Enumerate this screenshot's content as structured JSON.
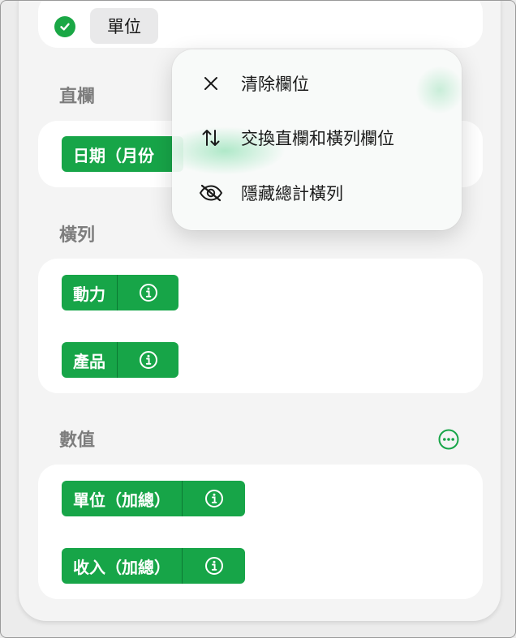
{
  "top_chip": {
    "label": "單位"
  },
  "sections": {
    "columns": {
      "title": "直欄",
      "chips": [
        {
          "label": "日期（月份"
        }
      ]
    },
    "rows": {
      "title": "橫列",
      "chips": [
        {
          "label": "動力"
        },
        {
          "label": "產品"
        }
      ]
    },
    "values": {
      "title": "數值",
      "chips": [
        {
          "label": "單位（加總）"
        },
        {
          "label": "收入（加總）"
        }
      ]
    }
  },
  "context_menu": {
    "items": [
      {
        "label": "清除欄位",
        "icon": "close-icon"
      },
      {
        "label": "交換直欄和橫列欄位",
        "icon": "swap-arrows-icon"
      },
      {
        "label": "隱藏總計橫列",
        "icon": "eye-slash-icon"
      }
    ]
  },
  "colors": {
    "accent": "#17a548",
    "menu_background": "#f8faf9",
    "section_title": "#7d7d7d"
  }
}
